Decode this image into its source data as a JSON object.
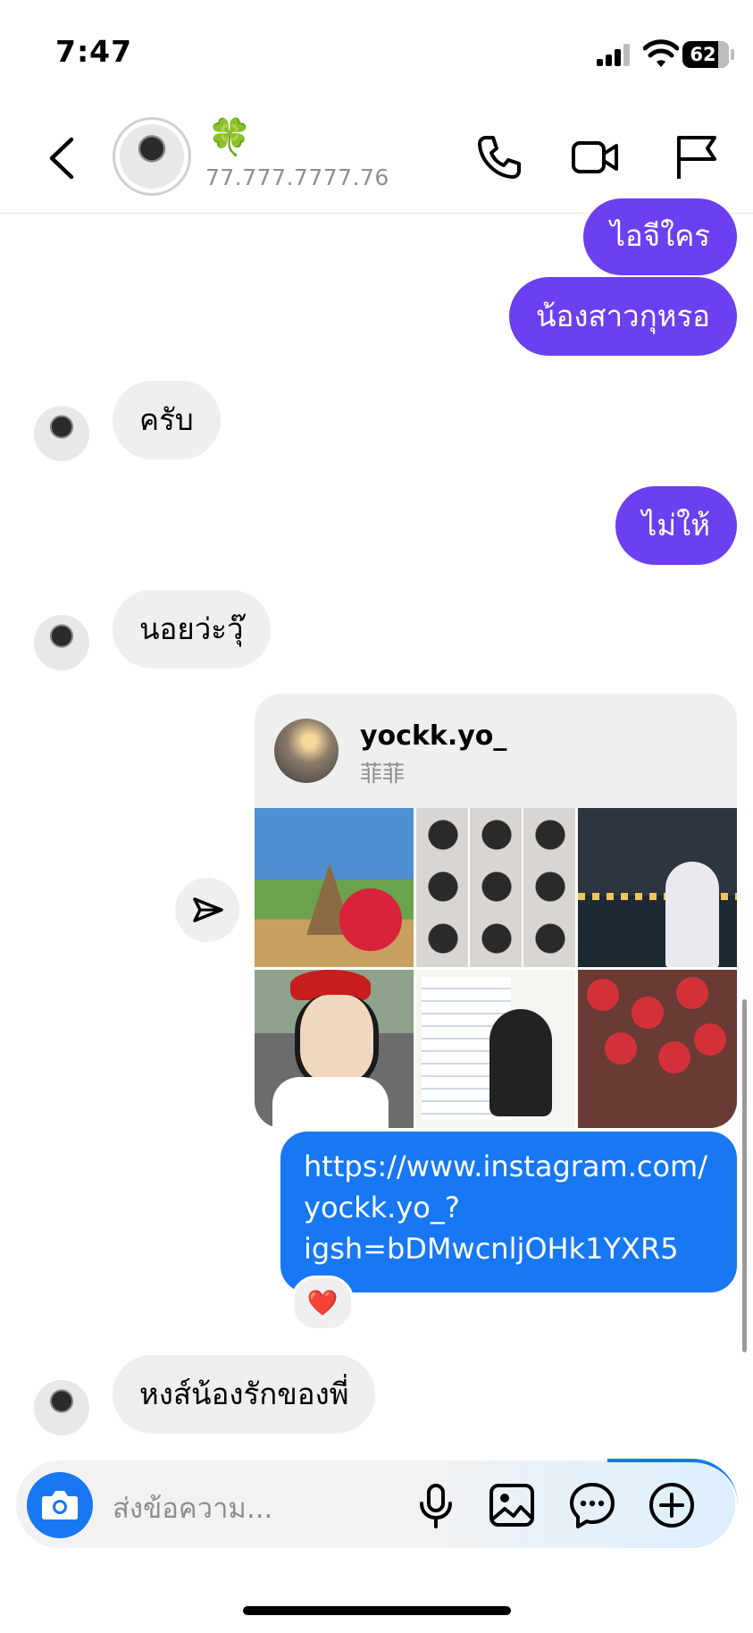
{
  "status_bar": {
    "time": "7:47",
    "battery": "62"
  },
  "header": {
    "emoji": "🍀",
    "handle": "77.777.7777.76",
    "icons": [
      "back-chevron-icon",
      "phone-icon",
      "video-camera-icon",
      "flag-icon"
    ]
  },
  "messages": [
    {
      "direction": "outgoing",
      "text": "ไอจีใคร"
    },
    {
      "direction": "outgoing",
      "text": "น้องสาวกุหรอ"
    },
    {
      "direction": "incoming",
      "text": "ครับ"
    },
    {
      "direction": "outgoing",
      "text": "ไม่ให้"
    },
    {
      "direction": "incoming",
      "text": "นอยว่ะวุ๊"
    },
    {
      "direction": "incoming",
      "text": "หงส์น้องรักของพี่"
    }
  ],
  "shared_post": {
    "username": "yockk.yo_",
    "subtitle": "菲菲",
    "tiles": [
      "temple-umbrella-photo",
      "selfie-collage-photo",
      "night-river-photo",
      "red-hat-photo",
      "poster-photo",
      "lanterns-photo"
    ]
  },
  "link_message": {
    "lines": [
      "https://www.instagram.com/",
      "yockk.yo_?",
      "igsh=bDMwcnljOHk1YXR5"
    ],
    "reaction": "❤️"
  },
  "composer": {
    "placeholder": "ส่งข้อความ...",
    "icons": [
      "camera-icon",
      "microphone-icon",
      "image-icon",
      "sticker-chat-icon",
      "plus-circle-icon"
    ]
  },
  "colors": {
    "outgoing_bubble": "#6c3ff0",
    "link_bubble": "#1877f2",
    "incoming_bubble": "#efefef",
    "accent": "#1877f2"
  }
}
